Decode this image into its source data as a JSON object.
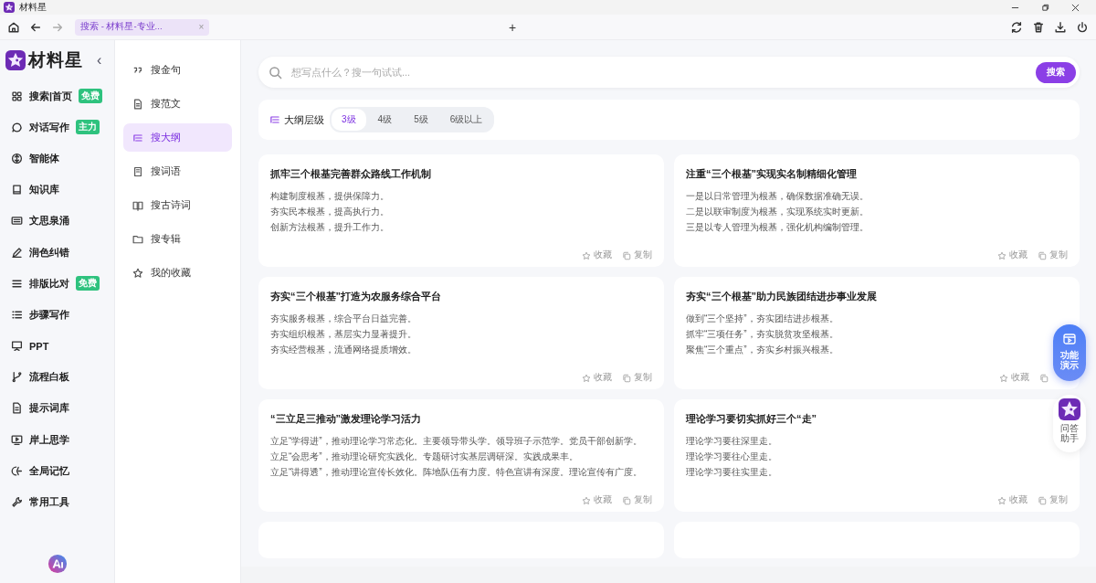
{
  "window": {
    "title": "材料星"
  },
  "browser_tab": {
    "title": "搜索 - 材料星-专业...",
    "close": "×"
  },
  "new_tab": "+",
  "sidebar": {
    "logo": "材料星",
    "collapse": "‹",
    "items": [
      {
        "label": "搜索|首页",
        "badge": "免费"
      },
      {
        "label": "对话写作",
        "badge": "主力"
      },
      {
        "label": "智能体"
      },
      {
        "label": "知识库"
      },
      {
        "label": "文思泉涌"
      },
      {
        "label": "润色纠错"
      },
      {
        "label": "排版比对",
        "badge": "免费"
      },
      {
        "label": "步骤写作"
      },
      {
        "label": "PPT"
      },
      {
        "label": "流程白板"
      },
      {
        "label": "提示词库"
      },
      {
        "label": "岸上思学"
      },
      {
        "label": "全局记忆"
      },
      {
        "label": "常用工具"
      }
    ]
  },
  "subnav": {
    "items": [
      {
        "label": "搜金句",
        "selected": false
      },
      {
        "label": "搜范文",
        "selected": false
      },
      {
        "label": "搜大纲",
        "selected": true
      },
      {
        "label": "搜词语",
        "selected": false
      },
      {
        "label": "搜古诗词",
        "selected": false
      },
      {
        "label": "搜专辑",
        "selected": false
      },
      {
        "label": "我的收藏",
        "selected": false
      }
    ]
  },
  "search": {
    "placeholder": "想写点什么？搜一句试试...",
    "button": "搜索"
  },
  "filter": {
    "label": "大纲层级",
    "options": [
      {
        "label": "3级",
        "selected": true
      },
      {
        "label": "4级",
        "selected": false
      },
      {
        "label": "5级",
        "selected": false
      },
      {
        "label": "6级以上",
        "selected": false
      }
    ]
  },
  "cards": [
    {
      "title": "抓牢三个根基完善群众路线工作机制",
      "lines": [
        "构建制度根基，提供保障力。",
        "夯实民本根基，提高执行力。",
        "创新方法根基，提升工作力。"
      ],
      "favorite": "收藏",
      "copy": "复制"
    },
    {
      "title": "注重“三个根基”实现实名制精细化管理",
      "lines": [
        "一是以日常管理为根基，确保数据准确无误。",
        "二是以联审制度为根基，实现系统实时更新。",
        "三是以专人管理为根基，强化机构编制管理。"
      ],
      "favorite": "收藏",
      "copy": "复制"
    },
    {
      "title": "夯实“三个根基”打造为农服务综合平台",
      "lines": [
        "夯实服务根基，综合平台日益完善。",
        "夯实组织根基，基层实力显著提升。",
        "夯实经营根基，流通网络提质增效。"
      ],
      "favorite": "收藏",
      "copy": "复制"
    },
    {
      "title": "夯实“三个根基”助力民族团结进步事业发展",
      "lines": [
        "做到“三个坚持”，夯实团结进步根基。",
        "抓牢“三项任务”，夯实脱贫攻坚根基。",
        "聚焦“三个重点”，夯实乡村振兴根基。"
      ],
      "favorite": "收藏"
    },
    {
      "title": "“三立足三推动”激发理论学习活力",
      "lines": [
        "立足“学得进”，推动理论学习常态化。主要领导带头学。领导班子示范学。党员干部创新学。",
        "立足“会思考”，推动理论研究实践化。专题研讨实基层调研深。实践成果丰。",
        "立足“讲得透”，推动理论宣传长效化。阵地队伍有力度。特色宣讲有深度。理论宣传有广度。"
      ],
      "favorite": "收藏",
      "copy": "复制"
    },
    {
      "title": "理论学习要切实抓好三个“走”",
      "lines": [
        "理论学习要往深里走。",
        "理论学习要往心里走。",
        "理论学习要往实里走。"
      ],
      "favorite": "收藏",
      "copy": "复制"
    }
  ],
  "floating": {
    "demo": "功能演示",
    "assistant": "问答助手"
  }
}
